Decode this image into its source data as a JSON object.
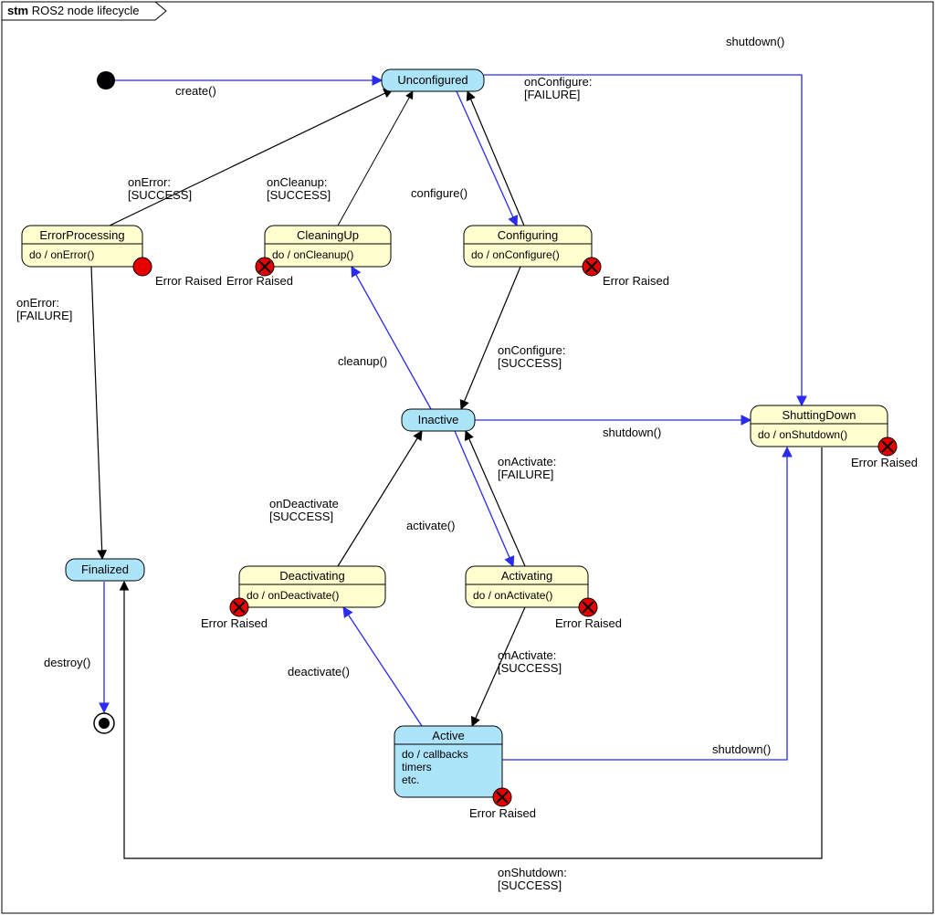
{
  "title_prefix": "stm",
  "title": "ROS2 node lifecycle",
  "error_label": "Error Raised",
  "states": {
    "Unconfigured": {
      "title": "Unconfigured",
      "sub": "",
      "kind": "primary"
    },
    "Configuring": {
      "title": "Configuring",
      "sub": "do / onConfigure()",
      "kind": "transition"
    },
    "CleaningUp": {
      "title": "CleaningUp",
      "sub": "do / onCleanup()",
      "kind": "transition"
    },
    "ErrorProcessing": {
      "title": "ErrorProcessing",
      "sub": "do / onError()",
      "kind": "transition"
    },
    "Inactive": {
      "title": "Inactive",
      "sub": "",
      "kind": "primary"
    },
    "Activating": {
      "title": "Activating",
      "sub": "do / onActivate()",
      "kind": "transition"
    },
    "Deactivating": {
      "title": "Deactivating",
      "sub": "do / onDeactivate()",
      "kind": "transition"
    },
    "Active": {
      "title": "Active",
      "sub": "do / callbacks\ntimers\netc.",
      "kind": "primary"
    },
    "ShuttingDown": {
      "title": "ShuttingDown",
      "sub": "do / onShutdown()",
      "kind": "transition"
    },
    "Finalized": {
      "title": "Finalized",
      "sub": "",
      "kind": "primary"
    }
  },
  "transitions": {
    "create": "create()",
    "configure": "configure()",
    "onConfigureFail": "onConfigure:\n[FAILURE]",
    "onConfigureSuccess": "onConfigure:\n[SUCCESS]",
    "cleanup": "cleanup()",
    "onCleanupSuccess": "onCleanup:\n[SUCCESS]",
    "activate": "activate()",
    "onActivateSuccess": "onActivate:\n[SUCCESS]",
    "onActivateFail": "onActivate:\n[FAILURE]",
    "deactivate": "deactivate()",
    "onDeactivateSuccess": "onDeactivate\n[SUCCESS]",
    "shutdown": "shutdown()",
    "onShutdownSuccess": "onShutdown:\n[SUCCESS]",
    "onErrorSuccess": "onError:\n[SUCCESS]",
    "onErrorFail": "onError:\n[FAILURE]",
    "destroy": "destroy()"
  },
  "colors": {
    "solidDot": "#000000",
    "errorDot": "#e60000",
    "blueEdge": "#2a2af0",
    "blackEdge": "#000000"
  },
  "chart_data": {
    "type": "state_machine",
    "title": "stm ROS2 node lifecycle",
    "initial": "Unconfigured",
    "final": "destroyed",
    "states": [
      {
        "id": "Unconfigured",
        "kind": "primary"
      },
      {
        "id": "Configuring",
        "kind": "transient",
        "do": "onConfigure()"
      },
      {
        "id": "CleaningUp",
        "kind": "transient",
        "do": "onCleanup()"
      },
      {
        "id": "Inactive",
        "kind": "primary"
      },
      {
        "id": "Activating",
        "kind": "transient",
        "do": "onActivate()"
      },
      {
        "id": "Deactivating",
        "kind": "transient",
        "do": "onDeactivate()"
      },
      {
        "id": "Active",
        "kind": "primary",
        "do": "callbacks, timers, etc."
      },
      {
        "id": "ShuttingDown",
        "kind": "transient",
        "do": "onShutdown()"
      },
      {
        "id": "ErrorProcessing",
        "kind": "transient",
        "do": "onError()"
      },
      {
        "id": "Finalized",
        "kind": "primary"
      }
    ],
    "edges": [
      {
        "from": "initial",
        "to": "Unconfigured",
        "label": "create()"
      },
      {
        "from": "Unconfigured",
        "to": "Configuring",
        "label": "configure()"
      },
      {
        "from": "Configuring",
        "to": "Inactive",
        "label": "onConfigure:[SUCCESS]"
      },
      {
        "from": "Configuring",
        "to": "Unconfigured",
        "label": "onConfigure:[FAILURE]"
      },
      {
        "from": "Inactive",
        "to": "CleaningUp",
        "label": "cleanup()"
      },
      {
        "from": "CleaningUp",
        "to": "Unconfigured",
        "label": "onCleanup:[SUCCESS]"
      },
      {
        "from": "Inactive",
        "to": "Activating",
        "label": "activate()"
      },
      {
        "from": "Activating",
        "to": "Active",
        "label": "onActivate:[SUCCESS]"
      },
      {
        "from": "Activating",
        "to": "Inactive",
        "label": "onActivate:[FAILURE]"
      },
      {
        "from": "Active",
        "to": "Deactivating",
        "label": "deactivate()"
      },
      {
        "from": "Deactivating",
        "to": "Inactive",
        "label": "onDeactivate[SUCCESS]"
      },
      {
        "from": "Unconfigured",
        "to": "ShuttingDown",
        "label": "shutdown()"
      },
      {
        "from": "Inactive",
        "to": "ShuttingDown",
        "label": "shutdown()"
      },
      {
        "from": "Active",
        "to": "ShuttingDown",
        "label": "shutdown()"
      },
      {
        "from": "ShuttingDown",
        "to": "Finalized",
        "label": "onShutdown:[SUCCESS]"
      },
      {
        "from": "ErrorProcessing",
        "to": "Unconfigured",
        "label": "onError:[SUCCESS]"
      },
      {
        "from": "ErrorProcessing",
        "to": "Finalized",
        "label": "onError:[FAILURE]"
      },
      {
        "from": "Finalized",
        "to": "final",
        "label": "destroy()"
      },
      {
        "from": "Configuring",
        "to": "ErrorProcessing",
        "label": "Error Raised"
      },
      {
        "from": "CleaningUp",
        "to": "ErrorProcessing",
        "label": "Error Raised"
      },
      {
        "from": "Activating",
        "to": "ErrorProcessing",
        "label": "Error Raised"
      },
      {
        "from": "Deactivating",
        "to": "ErrorProcessing",
        "label": "Error Raised"
      },
      {
        "from": "Active",
        "to": "ErrorProcessing",
        "label": "Error Raised"
      },
      {
        "from": "ShuttingDown",
        "to": "ErrorProcessing",
        "label": "Error Raised"
      }
    ]
  }
}
